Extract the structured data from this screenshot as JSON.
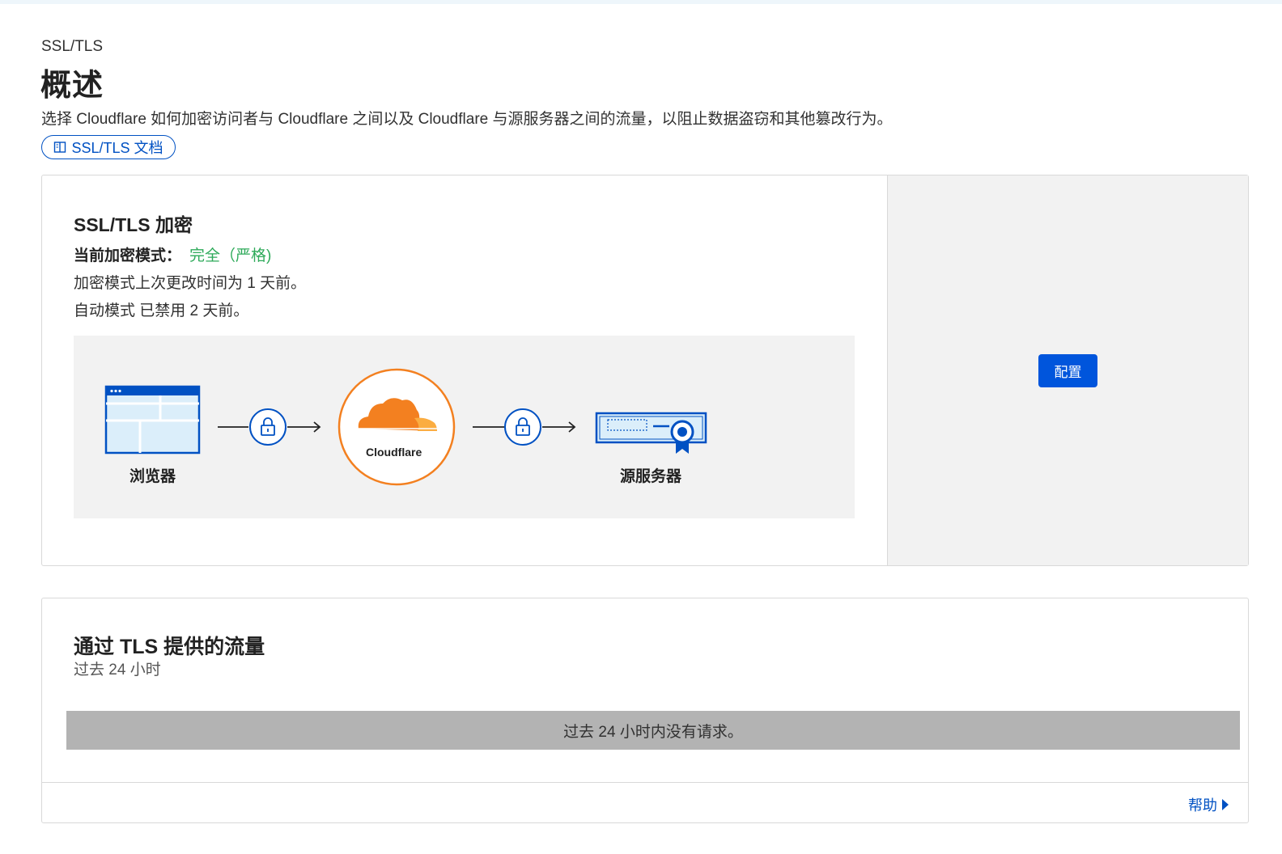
{
  "header": {
    "breadcrumb": "SSL/TLS",
    "title": "概述",
    "description": "选择 Cloudflare 如何加密访问者与 Cloudflare 之间以及 Cloudflare 与源服务器之间的流量，以阻止数据盗窃和其他篡改行为。",
    "docs_link": "SSL/TLS 文档"
  },
  "encryption": {
    "title": "SSL/TLS 加密",
    "mode_label": "当前加密模式：",
    "mode_value": "完全（严格)",
    "changed_text": "加密模式上次更改时间为 1 天前。",
    "auto_text": "自动模式 已禁用 2 天前。",
    "diagram": {
      "browser_label": "浏览器",
      "cloudflare_label": "Cloudflare",
      "origin_label": "源服务器"
    },
    "configure_button": "配置"
  },
  "traffic": {
    "title": "通过 TLS 提供的流量",
    "subtitle": "过去 24 小时",
    "empty_message": "过去 24 小时内没有请求。",
    "help_link": "帮助"
  },
  "colors": {
    "accent_blue": "#0051c3",
    "button_blue": "#0055dc",
    "success_green": "#2eaa5a",
    "cloudflare_orange": "#f38020"
  }
}
